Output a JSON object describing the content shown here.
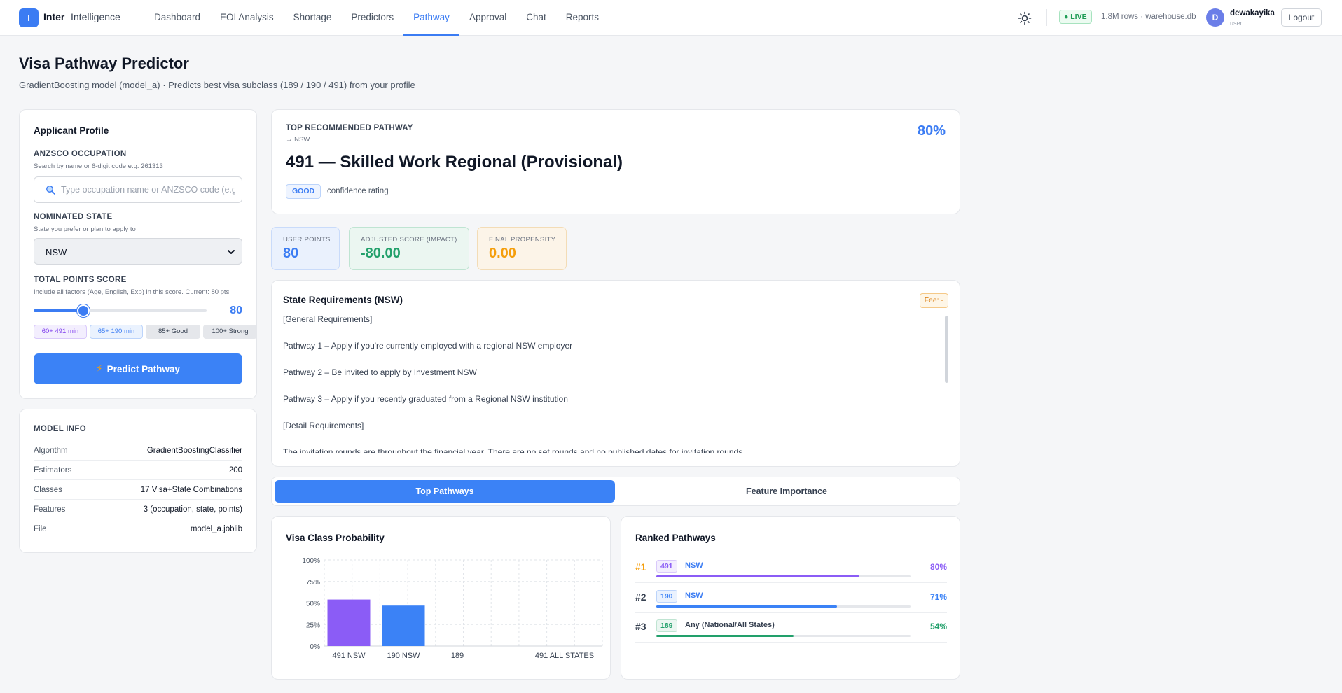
{
  "app": {
    "logo_letter": "I",
    "brand_strong": "Inter",
    "brand_rest": "Intelligence"
  },
  "nav": [
    {
      "label": "Dashboard"
    },
    {
      "label": "EOI Analysis"
    },
    {
      "label": "Shortage"
    },
    {
      "label": "Predictors"
    },
    {
      "label": "Pathway",
      "active": true
    },
    {
      "label": "Approval"
    },
    {
      "label": "Chat"
    },
    {
      "label": "Reports"
    }
  ],
  "header": {
    "theme_icon": "sun-icon",
    "live": "● LIVE",
    "data_info": "1.8M rows · warehouse.db",
    "avatar_letter": "D",
    "username": "dewakayika",
    "role": "user",
    "logout": "Logout"
  },
  "page": {
    "title": "Visa Pathway Predictor",
    "subtitle": "GradientBoosting model (model_a) · Predicts best visa subclass (189 / 190 / 491) from your profile"
  },
  "profile": {
    "title": "Applicant Profile",
    "occupation": {
      "label": "ANZSCO OCCUPATION",
      "hint": "Search by name or 6-digit code e.g. 261313",
      "placeholder": "Type occupation name or ANZSCO code (e.g. 261313)",
      "value": ""
    },
    "state": {
      "label": "NOMINATED STATE",
      "hint": "State you prefer or plan to apply to",
      "value": "NSW"
    },
    "points": {
      "label": "TOTAL POINTS SCORE",
      "hint": "Include all factors (Age, English, Exp) in this score. Current: 80 pts",
      "value": 80,
      "value_text": "80",
      "min": 60,
      "max": 130
    },
    "chips": [
      {
        "label": "60+ 491 min",
        "bg": "#f3eefe",
        "border": "#d9c9fb",
        "color": "#7c3aed",
        "w": 76
      },
      {
        "label": "65+ 190 min",
        "bg": "#eaf2fe",
        "border": "#bcd4fb",
        "color": "#3b7cf3",
        "w": 76
      },
      {
        "label": "85+ Good",
        "bg": "#e5e7eb",
        "border": "#e5e7eb",
        "color": "#374151",
        "w": 78
      },
      {
        "label": "100+ Strong",
        "bg": "#e5e7eb",
        "border": "#e5e7eb",
        "color": "#374151",
        "w": 77
      }
    ],
    "predict_label": "Predict Pathway"
  },
  "model_info": {
    "title": "MODEL INFO",
    "rows": [
      {
        "k": "Algorithm",
        "v": "GradientBoostingClassifier"
      },
      {
        "k": "Estimators",
        "v": "200"
      },
      {
        "k": "Classes",
        "v": "17 Visa+State Combinations"
      },
      {
        "k": "Features",
        "v": "3 (occupation, state, points)"
      },
      {
        "k": "File",
        "v": "model_a.joblib"
      }
    ]
  },
  "recommendation": {
    "label": "TOP RECOMMENDED PATHWAY",
    "sub": "→ NSW",
    "title": "491 — Skilled Work Regional (Provisional)",
    "badge": "GOOD",
    "badge_text": "confidence rating",
    "percent": "80%"
  },
  "stats": [
    {
      "label": "USER POINTS",
      "value": "80",
      "bg": "#eaf1fd",
      "border": "#c9dbfa",
      "color": "#3b7cf3"
    },
    {
      "label": "ADJUSTED SCORE (IMPACT)",
      "value": "-80.00",
      "bg": "#ebf6f1",
      "border": "#bfe4d2",
      "color": "#22a06b"
    },
    {
      "label": "FINAL PROPENSITY",
      "value": "0.00",
      "bg": "#fcf4e8",
      "border": "#f3dcb6",
      "color": "#f59e0b"
    }
  ],
  "requirements": {
    "title": "State Requirements (NSW)",
    "fee": "Fee: -",
    "lines": [
      "[General Requirements]",
      "Pathway 1 – Apply if you're currently employed with a regional NSW employer",
      "Pathway 2 – Be invited to apply by Investment NSW",
      "Pathway 3 – Apply if you recently graduated from a Regional NSW institution",
      "[Detail Requirements]",
      "The invitation rounds are throughout the financial year. There are no set rounds and no published dates for invitation rounds."
    ]
  },
  "tabs": [
    {
      "label": "Top Pathways",
      "active": true
    },
    {
      "label": "Feature Importance",
      "active": false
    }
  ],
  "chart_data": {
    "type": "bar",
    "title": "Visa Class Probability",
    "categories": [
      "491 NSW",
      "190 NSW",
      "189",
      "491 ALL STATES"
    ],
    "values": [
      54,
      47,
      0,
      0
    ],
    "colors": [
      "#8b5cf6",
      "#3b82f6",
      "#22a06b",
      "#f59e0b"
    ],
    "ylim": [
      0,
      100
    ],
    "yticks": [
      "0%",
      "25%",
      "50%",
      "75%",
      "100%"
    ],
    "grid": true
  },
  "ranked": {
    "title": "Ranked Pathways",
    "items": [
      {
        "rank": "#1",
        "code": "491",
        "state": "NSW",
        "pct": "80%",
        "value": 80,
        "color": "#8b5cf6",
        "code_bg": "#f3eefe",
        "code_border": "#d9c9fb",
        "rank_color": "#f59e0b",
        "state_color": "#3b7cf3"
      },
      {
        "rank": "#2",
        "code": "190",
        "state": "NSW",
        "pct": "71%",
        "value": 71,
        "color": "#3b82f6",
        "code_bg": "#eaf2fe",
        "code_border": "#bcd4fb",
        "rank_color": "#374151",
        "state_color": "#3b7cf3"
      },
      {
        "rank": "#3",
        "code": "189",
        "state": "Any (National/All States)",
        "pct": "54%",
        "value": 54,
        "color": "#22a06b",
        "code_bg": "#ebf6f1",
        "code_border": "#bfe4d2",
        "rank_color": "#374151",
        "state_color": "#374151"
      }
    ]
  }
}
